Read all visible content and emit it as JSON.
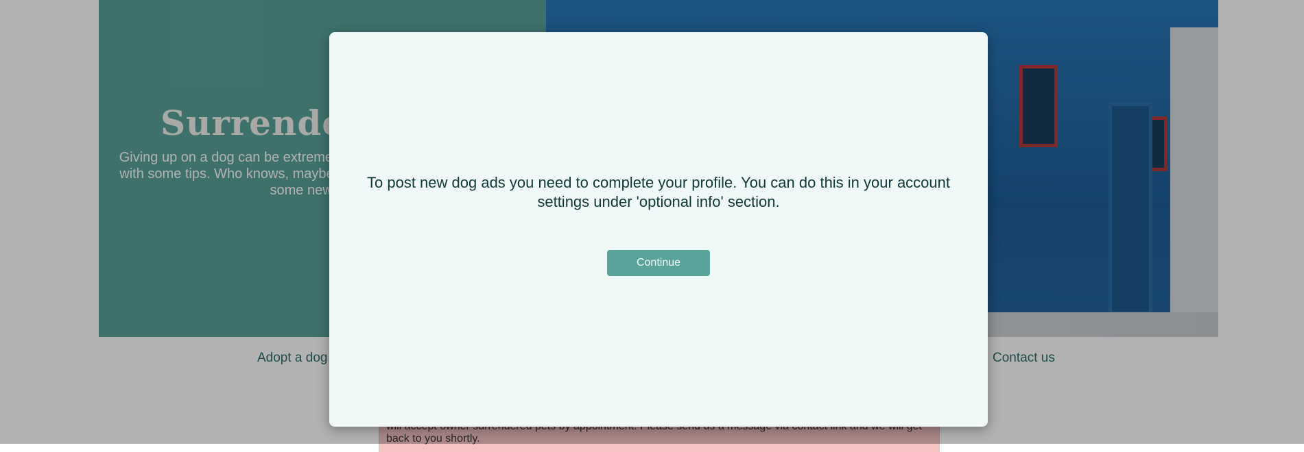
{
  "hero": {
    "title": "Surrender a dog",
    "subtitle": "Giving up on a dog can be extremely hard. Maybe we can help you with some tips. Who knows, maybe together we can help them find some new family."
  },
  "nav": {
    "items": [
      "Adopt a dog",
      "Contact us"
    ]
  },
  "content": {
    "text": "will accept owner surrendered pets by appointment. Please send us a message via contact link and we will get back to you shortly."
  },
  "modal": {
    "message": "To post new dog ads you need to complete your profile. You can do this in your account settings under 'optional info' section.",
    "button_label": "Continue"
  },
  "colors": {
    "accent": "#5aa39b",
    "modal_bg": "#f1f9f8",
    "text_dark": "#0f3838"
  }
}
